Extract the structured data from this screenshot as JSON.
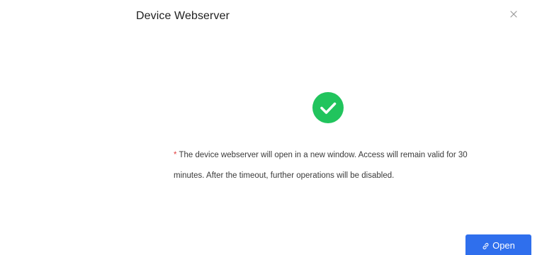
{
  "dialog": {
    "title": "Device Webserver",
    "close_icon": "close-icon",
    "status_icon": "check-circle-icon",
    "status_color": "#21c45d",
    "message": {
      "required_marker": "*",
      "text": "The device webserver will open in a new window. Access will remain valid for 30 minutes. After the timeout, further operations will be disabled."
    },
    "open_button": {
      "icon": "link-icon",
      "label": "Open",
      "color": "#2f6fed"
    }
  }
}
